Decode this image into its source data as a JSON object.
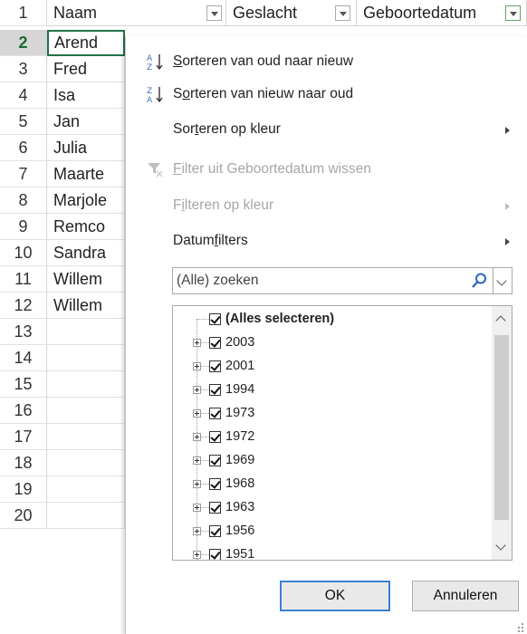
{
  "sheet": {
    "columns": {
      "a": "Naam",
      "b": "Geslacht",
      "c": "Geboortedatum"
    },
    "rows": [
      {
        "num": "1",
        "a": "Naam"
      },
      {
        "num": "2",
        "a": "Arend"
      },
      {
        "num": "3",
        "a": "Fred"
      },
      {
        "num": "4",
        "a": "Isa"
      },
      {
        "num": "5",
        "a": "Jan"
      },
      {
        "num": "6",
        "a": "Julia"
      },
      {
        "num": "7",
        "a": "Maarte"
      },
      {
        "num": "8",
        "a": "Marjole"
      },
      {
        "num": "9",
        "a": "Remco"
      },
      {
        "num": "10",
        "a": "Sandra"
      },
      {
        "num": "11",
        "a": "Willem"
      },
      {
        "num": "12",
        "a": "Willem"
      },
      {
        "num": "13",
        "a": ""
      },
      {
        "num": "14",
        "a": ""
      },
      {
        "num": "15",
        "a": ""
      },
      {
        "num": "16",
        "a": ""
      },
      {
        "num": "17",
        "a": ""
      },
      {
        "num": "18",
        "a": ""
      },
      {
        "num": "19",
        "a": ""
      },
      {
        "num": "20",
        "a": ""
      }
    ],
    "accent": "#217346"
  },
  "menu": {
    "sort_asc": {
      "pre": "",
      "u": "S",
      "post": "orteren van oud naar nieuw"
    },
    "sort_desc": {
      "pre": "S",
      "u": "o",
      "post": "rteren van nieuw naar oud"
    },
    "sort_color": {
      "pre": "Sor",
      "u": "t",
      "post": "eren op kleur"
    },
    "clear_filter": {
      "pre": "",
      "u": "F",
      "post": "ilter uit Geboortedatum wissen"
    },
    "filter_color": {
      "pre": "F",
      "u": "i",
      "post": "lteren op kleur"
    },
    "date_filters": {
      "pre": "Datum",
      "u": "f",
      "post": "ilters"
    }
  },
  "search": {
    "placeholder": "(Alle) zoeken"
  },
  "list": {
    "items": [
      "(Alles selecteren)",
      "2003",
      "2001",
      "1994",
      "1973",
      "1972",
      "1969",
      "1968",
      "1963",
      "1956",
      "1951"
    ]
  },
  "buttons": {
    "ok": "OK",
    "cancel": "Annuleren",
    "ok_border": "#3c7fd1"
  },
  "icons": {
    "sort_asc": "sort-a-z-icon",
    "sort_desc": "sort-z-a-icon",
    "clear_filter": "clear-filter-icon",
    "search": "magnifier-icon"
  }
}
